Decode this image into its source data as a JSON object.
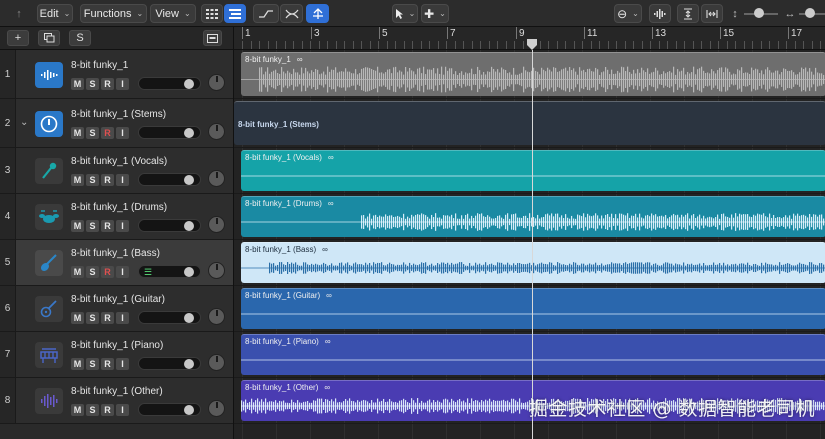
{
  "toolbar": {
    "edit_label": "Edit",
    "functions_label": "Functions",
    "view_label": "View"
  },
  "header_bar": {
    "add_label": "+",
    "solo_label": "S"
  },
  "ruler": {
    "bars": [
      "1",
      "3",
      "5",
      "7",
      "9",
      "11",
      "13",
      "15",
      "17"
    ]
  },
  "tracks": [
    {
      "num": "1",
      "name": "8-bit funky_1",
      "buttons": [
        "M",
        "S",
        "R",
        "I"
      ],
      "region": "8-bit funky_1",
      "color": "#6e6e6e",
      "icon": "waveform-icon"
    },
    {
      "num": "2",
      "name": "8-bit funky_1 (Stems)",
      "buttons": [
        "M",
        "S",
        "R",
        "I"
      ],
      "region": "8-bit funky_1 (Stems)",
      "color": "#2b3440",
      "icon": "stems-icon"
    },
    {
      "num": "3",
      "name": "8-bit funky_1 (Vocals)",
      "buttons": [
        "M",
        "S",
        "R",
        "I"
      ],
      "region": "8-bit funky_1 (Vocals)",
      "color": "#15a3a8",
      "icon": "microphone-icon"
    },
    {
      "num": "4",
      "name": "8-bit funky_1 (Drums)",
      "buttons": [
        "M",
        "S",
        "R",
        "I"
      ],
      "region": "8-bit funky_1 (Drums)",
      "color": "#1a8aa3",
      "icon": "drums-icon"
    },
    {
      "num": "5",
      "name": "8-bit funky_1 (Bass)",
      "buttons": [
        "M",
        "S",
        "R",
        "I"
      ],
      "region": "8-bit funky_1 (Bass)",
      "color": "#1f7ab3",
      "icon": "bass-guitar-icon"
    },
    {
      "num": "6",
      "name": "8-bit funky_1 (Guitar)",
      "buttons": [
        "M",
        "S",
        "R",
        "I"
      ],
      "region": "8-bit funky_1 (Guitar)",
      "color": "#2a67ad",
      "icon": "guitar-icon"
    },
    {
      "num": "7",
      "name": "8-bit funky_1 (Piano)",
      "buttons": [
        "M",
        "S",
        "R",
        "I"
      ],
      "region": "8-bit funky_1 (Piano)",
      "color": "#3a50ae",
      "icon": "piano-icon"
    },
    {
      "num": "8",
      "name": "8-bit funky_1 (Other)",
      "buttons": [
        "M",
        "S",
        "R",
        "I"
      ],
      "region": "8-bit funky_1 (Other)",
      "color": "#4a3cb2",
      "icon": "other-waveform-icon"
    }
  ],
  "watermark": "掘金技术社区 @ 数据智能老司机"
}
